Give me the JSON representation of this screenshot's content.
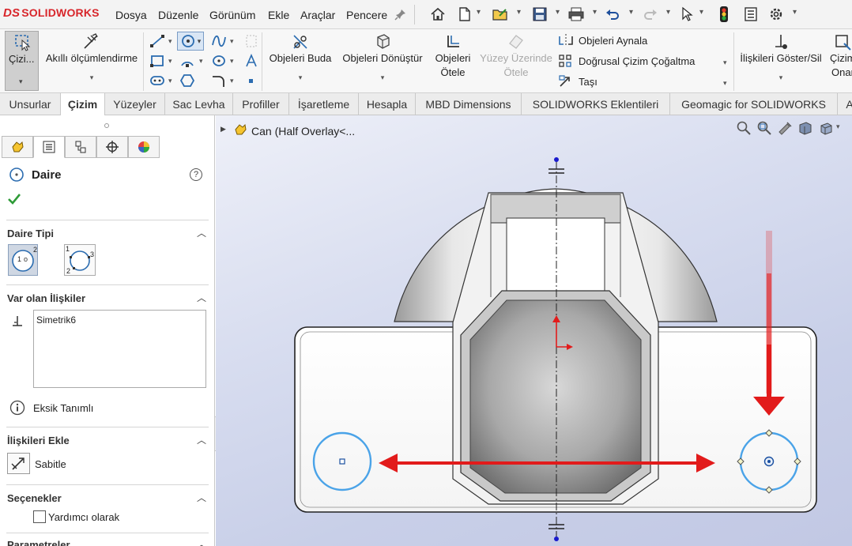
{
  "app": {
    "logo_prefix": "DS",
    "logo_text": "SOLIDWORKS"
  },
  "menu": [
    "Dosya",
    "Düzenle",
    "Görünüm",
    "Ekle",
    "Araçlar",
    "Pencere"
  ],
  "commands": {
    "exit_sketch": "Çizi...",
    "smart_dimension": "Akıllı ölçümlendirme",
    "trim": "Objeleri Buda",
    "convert": "Objeleri Dönüştür",
    "offset_line1": "Objeleri",
    "offset_line2": "Ötele",
    "surface_offset_line1": "Yüzey Üzerinde",
    "surface_offset_line2": "Ötele",
    "mirror": "Objeleri Aynala",
    "linear_pattern": "Doğrusal Çizim Çoğaltma",
    "move": "Taşı",
    "show_relations": "İlişkileri Göster/Sil",
    "repair_line1": "Çizim",
    "repair_line2": "Onar"
  },
  "tabs": [
    "Unsurlar",
    "Çizim",
    "Yüzeyler",
    "Sac Levha",
    "Profiller",
    "İşaretleme",
    "Hesapla",
    "MBD Dimensions",
    "SOLIDWORKS Eklentileri",
    "Geomagic for SOLIDWORKS",
    "A"
  ],
  "active_tab": "Çizim",
  "property_manager": {
    "title": "Daire",
    "help": "?",
    "section_type": "Daire Tipi",
    "circle_type_center": "1",
    "circle_type_radius": "2",
    "circle_type_p1": "1",
    "circle_type_p2": "2",
    "circle_type_p3": "3",
    "section_existing": "Var olan İlişkiler",
    "relations": [
      "Simetrik6"
    ],
    "status": "Eksik Tanımlı",
    "section_add": "İlişkileri Ekle",
    "add_fix": "Sabitle",
    "section_options": "Seçenekler",
    "option_construction": "Yardımcı olarak",
    "section_params": "Parametreler"
  },
  "tree": {
    "label": "Can  (Half Overlay<..."
  },
  "colors": {
    "accent": "#2b6cb0",
    "sketch_blue": "#4aa3e8",
    "arrow_red": "#e21b1b",
    "active_tab_bg": "#ffffff"
  }
}
